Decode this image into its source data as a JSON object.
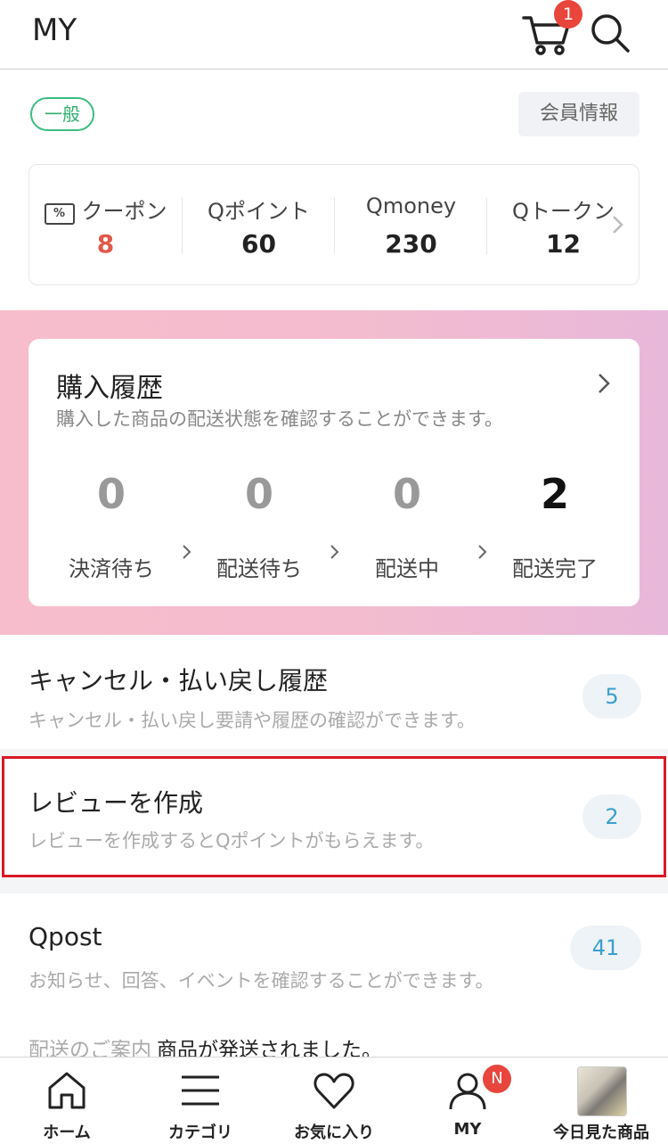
{
  "header": {
    "title": "MY",
    "cart_badge": "1"
  },
  "member": {
    "grade": "一般",
    "info_button": "会員情報"
  },
  "assets": {
    "items": [
      {
        "label": "クーポン",
        "value": "8",
        "icon": "coupon-icon"
      },
      {
        "label": "Qポイント",
        "value": "60"
      },
      {
        "label": "Qmoney",
        "value": "230"
      },
      {
        "label": "Qトークン",
        "value": "12"
      }
    ],
    "coupon_icon_text": "%"
  },
  "purchase_history": {
    "title": "購入履歴",
    "desc": "購入した商品の配送状態を確認することができます。",
    "stats": [
      {
        "label": "決済待ち",
        "count": "0"
      },
      {
        "label": "配送待ち",
        "count": "0"
      },
      {
        "label": "配送中",
        "count": "0"
      },
      {
        "label": "配送完了",
        "count": "2"
      }
    ]
  },
  "menu": [
    {
      "title": "キャンセル・払い戻し履歴",
      "desc": "キャンセル・払い戻し要請や履歴の確認ができます。",
      "count": "5"
    },
    {
      "title": "レビューを作成",
      "desc": "レビューを作成するとQポイントがもらえます。",
      "count": "2"
    },
    {
      "title": "Qpost",
      "desc": "お知らせ、回答、イベントを確認することができます。",
      "count": "41"
    }
  ],
  "notice": {
    "tag": "配送のご案内",
    "message": "商品が発送されました。"
  },
  "nav": {
    "items": [
      {
        "label": "ホーム",
        "icon": "home-icon"
      },
      {
        "label": "カテゴリ",
        "icon": "menu-icon"
      },
      {
        "label": "お気に入り",
        "icon": "heart-icon"
      },
      {
        "label": "MY",
        "icon": "user-icon",
        "badge": "N"
      },
      {
        "label": "今日見た商品",
        "icon": "recent-product-thumbnail"
      }
    ]
  },
  "colors": {
    "accent_red": "#e8453c",
    "grade_green": "#2fae70",
    "count_blue": "#3aa0cf",
    "highlight_border": "#d81924"
  }
}
